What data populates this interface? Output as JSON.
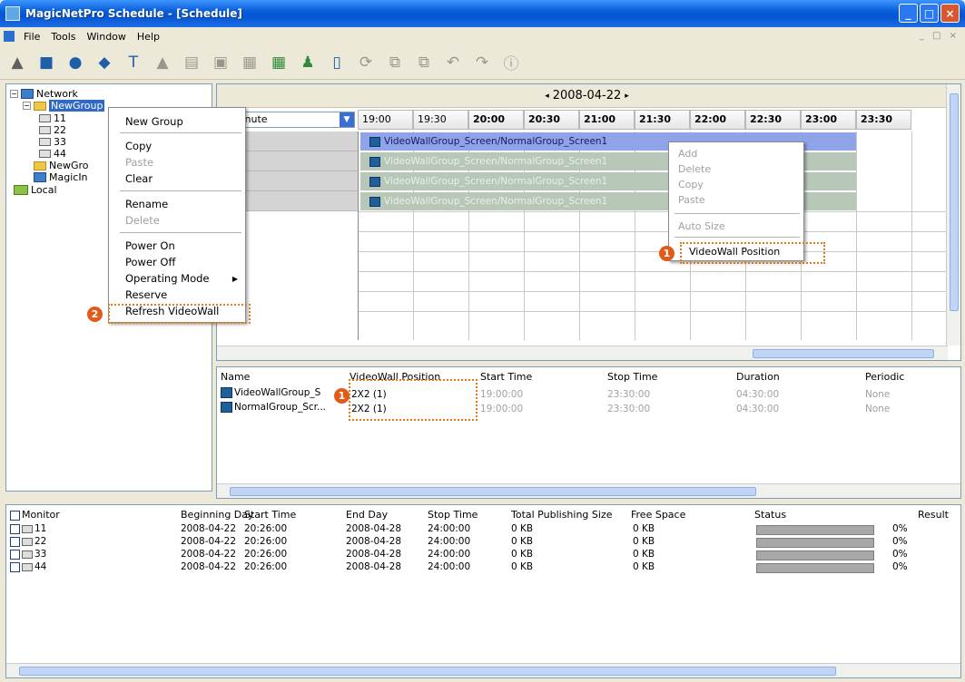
{
  "window": {
    "title": "MagicNetPro Schedule - [Schedule]"
  },
  "menu": [
    "File",
    "Tools",
    "Window",
    "Help"
  ],
  "tree": {
    "network": "Network",
    "group1": "NewGroup",
    "children": [
      "11",
      "22",
      "33",
      "44"
    ],
    "group2": "NewGro",
    "magic": "MagicIn",
    "local": "Local"
  },
  "context_menu_left": {
    "items": [
      "New Group",
      "Copy",
      "Paste",
      "Clear",
      "Rename",
      "Delete",
      "Power On",
      "Power Off",
      "Operating Mode",
      "Reserve",
      "Refresh VideoWall"
    ]
  },
  "schedule": {
    "date": "2008-04-22",
    "unit": "Minute",
    "times": [
      "19:00",
      "19:30",
      "20:00",
      "20:30",
      "21:00",
      "21:30",
      "22:00",
      "22:30",
      "23:00",
      "23:30"
    ],
    "rows": [
      "1",
      "2",
      "3",
      "4"
    ],
    "bar_primary": "VideoWallGroup_Screen/NormalGroup_Screen1",
    "bar_ghost": "VideoWallGroup_Screen/NormalGroup_Screen1"
  },
  "context_menu_right": {
    "items": [
      "Add",
      "Delete",
      "Copy",
      "Paste",
      "Auto Size",
      "VideoWall Position"
    ]
  },
  "detail": {
    "headers": [
      "Name",
      "VideoWall Position",
      "Start Time",
      "Stop Time",
      "Duration",
      "Periodic"
    ],
    "rows": [
      {
        "name": "VideoWallGroup_S",
        "pos": "2X2 (1)",
        "start": "19:00:00",
        "stop": "23:30:00",
        "duration": "04:30:00",
        "periodic": "None"
      },
      {
        "name": "NormalGroup_Scr...",
        "pos": "2X2 (1)",
        "start": "19:00:00",
        "stop": "23:30:00",
        "duration": "04:30:00",
        "periodic": "None"
      }
    ]
  },
  "monitor": {
    "headers": [
      "Monitor",
      "Beginning Day",
      "Start Time",
      "End Day",
      "Stop Time",
      "Total Publishing Size",
      "Free Space",
      "Status",
      "Result"
    ],
    "rows": [
      {
        "name": "11",
        "begin": "2008-04-22",
        "start": "20:26:00",
        "end": "2008-04-28",
        "stop": "24:00:00",
        "size": "0 KB",
        "free": "0 KB",
        "progress": 0,
        "pct": "0%"
      },
      {
        "name": "22",
        "begin": "2008-04-22",
        "start": "20:26:00",
        "end": "2008-04-28",
        "stop": "24:00:00",
        "size": "0 KB",
        "free": "0 KB",
        "progress": 0,
        "pct": "0%"
      },
      {
        "name": "33",
        "begin": "2008-04-22",
        "start": "20:26:00",
        "end": "2008-04-28",
        "stop": "24:00:00",
        "size": "0 KB",
        "free": "0 KB",
        "progress": 0,
        "pct": "0%"
      },
      {
        "name": "44",
        "begin": "2008-04-22",
        "start": "20:26:00",
        "end": "2008-04-28",
        "stop": "24:00:00",
        "size": "0 KB",
        "free": "0 KB",
        "progress": 0,
        "pct": "0%"
      }
    ]
  },
  "annotations": {
    "marker1": "1",
    "marker2": "2"
  },
  "colors": {
    "annotation": "#e07a1a",
    "titlebar": "#0a5fd9",
    "bar_primary": "#8fa3e8"
  }
}
